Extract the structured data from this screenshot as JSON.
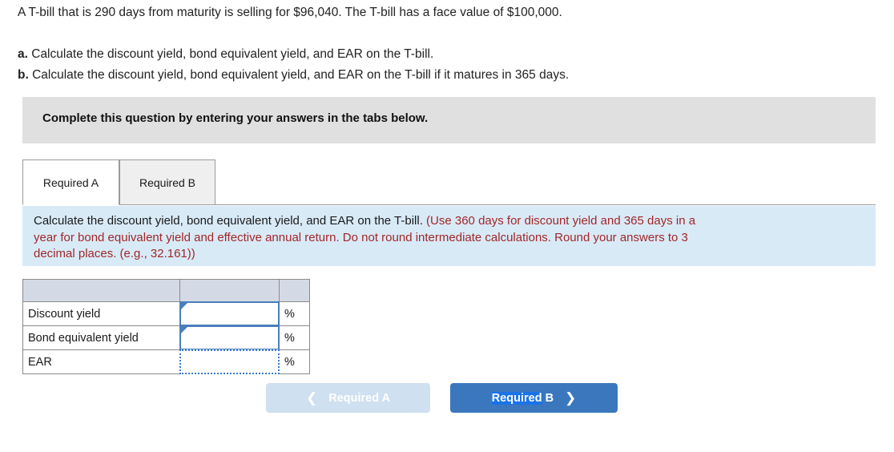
{
  "problem": {
    "stem": "A T-bill that is 290 days from maturity is selling for $96,040. The T-bill has a face value of $100,000.",
    "part_a_marker": "a.",
    "part_a_text": " Calculate the discount yield, bond equivalent yield, and EAR on the T-bill.",
    "part_b_marker": "b.",
    "part_b_text": " Calculate the discount yield, bond equivalent yield, and EAR on the T-bill if it matures in 365 days."
  },
  "banner": {
    "text": "Complete this question by entering your answers in the tabs below."
  },
  "tabs": [
    {
      "label": "Required A",
      "active": true
    },
    {
      "label": "Required B",
      "active": false
    }
  ],
  "info_panel": {
    "main_text": "Calculate the discount yield, bond equivalent yield, and EAR on the T-bill. ",
    "hint_line1": "(Use 360 days for discount yield and 365 days in a",
    "hint_line2": "year for bond equivalent yield and effective annual return. Do not round intermediate calculations. Round your answers to 3",
    "hint_line3": "decimal places. (e.g., 32.161))"
  },
  "answer_table": {
    "header": [
      "",
      "",
      ""
    ],
    "rows": [
      {
        "label": "Discount yield",
        "value": "",
        "unit": "%",
        "state": "editable"
      },
      {
        "label": "Bond equivalent yield",
        "value": "",
        "unit": "%",
        "state": "editable"
      },
      {
        "label": "EAR",
        "value": "",
        "unit": "%",
        "state": "selected-dotted"
      }
    ]
  },
  "nav": {
    "prev_label": "Required A",
    "prev_icon": "chevron-left-icon",
    "prev_disabled": true,
    "next_label_selected": "Required",
    "next_label_rest": " B",
    "next_icon": "chevron-right-icon"
  },
  "colors": {
    "banner_bg": "#e0e0e0",
    "info_panel_bg": "#d9eaf7",
    "hint_text": "#a02727",
    "table_header_bg": "#d4dae5",
    "cell_border_blue": "#4a7ebb",
    "next_button_bg": "#3b77bc",
    "prev_button_bg": "#cfe0f0",
    "selection_highlight": "#1a73e8"
  }
}
